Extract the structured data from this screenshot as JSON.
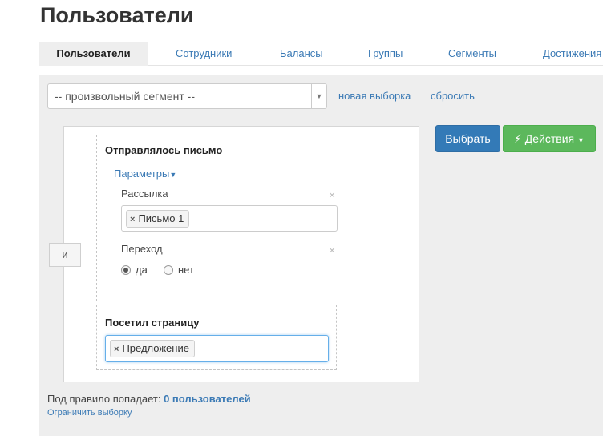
{
  "page": {
    "title": "Пользователи"
  },
  "tabs": [
    {
      "label": "Пользователи",
      "active": true
    },
    {
      "label": "Сотрудники"
    },
    {
      "label": "Балансы"
    },
    {
      "label": "Группы"
    },
    {
      "label": "Сегменты"
    },
    {
      "label": "Достижения"
    }
  ],
  "segment": {
    "selected": "-- произвольный сегмент --",
    "new_selection": "новая выборка",
    "reset": "сбросить"
  },
  "rules": {
    "and_label": "и",
    "sent_email": {
      "title": "Отправлялось письмо",
      "params_toggle": "Параметры",
      "mailing_label": "Рассылка",
      "mailing_tag": "Письмо 1",
      "click_label": "Переход",
      "yes": "да",
      "no": "нет",
      "selected_option": "да"
    },
    "visited_page": {
      "title": "Посетил страницу",
      "tag": "Предложение"
    }
  },
  "actions": {
    "select": "Выбрать",
    "actions": "Действия"
  },
  "summary": {
    "prefix": "Под правило попадает:",
    "count": "0 пользователей",
    "limit_link": "Ограничить выборку"
  },
  "colors": {
    "primary": "#337ab7",
    "success": "#5cb85c",
    "link": "#3b7ab5",
    "panel_bg": "#eeeeee"
  }
}
